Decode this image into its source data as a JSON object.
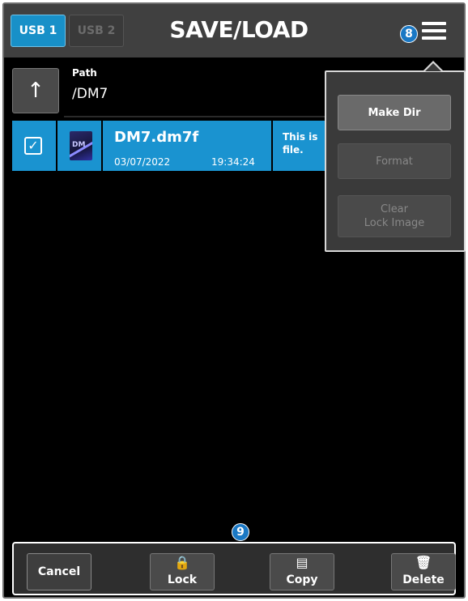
{
  "header": {
    "tabs": [
      {
        "label": "USB 1",
        "active": true
      },
      {
        "label": "USB 2",
        "active": false
      }
    ],
    "title": "SAVE/LOAD",
    "menu_icon": "hamburger-menu-icon"
  },
  "badges": {
    "menu": "8",
    "toolbar": "9"
  },
  "path": {
    "label": "Path",
    "value": "/DM7",
    "up_icon": "↑"
  },
  "files": [
    {
      "checked": true,
      "icon": "dm7-file-icon",
      "icon_text": "DM",
      "name": "DM7.dm7f",
      "date": "03/07/2022",
      "time": "19:34:24",
      "comment": "This is\nfile."
    }
  ],
  "dropdown": {
    "make_dir": "Make Dir",
    "format": "Format",
    "clear_lock_image": "Clear\nLock Image"
  },
  "toolbar": {
    "cancel": "Cancel",
    "lock": "Lock",
    "copy": "Copy",
    "delete": "Delete",
    "lock_icon": "🔒",
    "copy_icon": "▤",
    "delete_icon": "🗑"
  },
  "colors": {
    "accent": "#1a93d0",
    "badge": "#1a78c4",
    "header_bg": "#404040"
  }
}
